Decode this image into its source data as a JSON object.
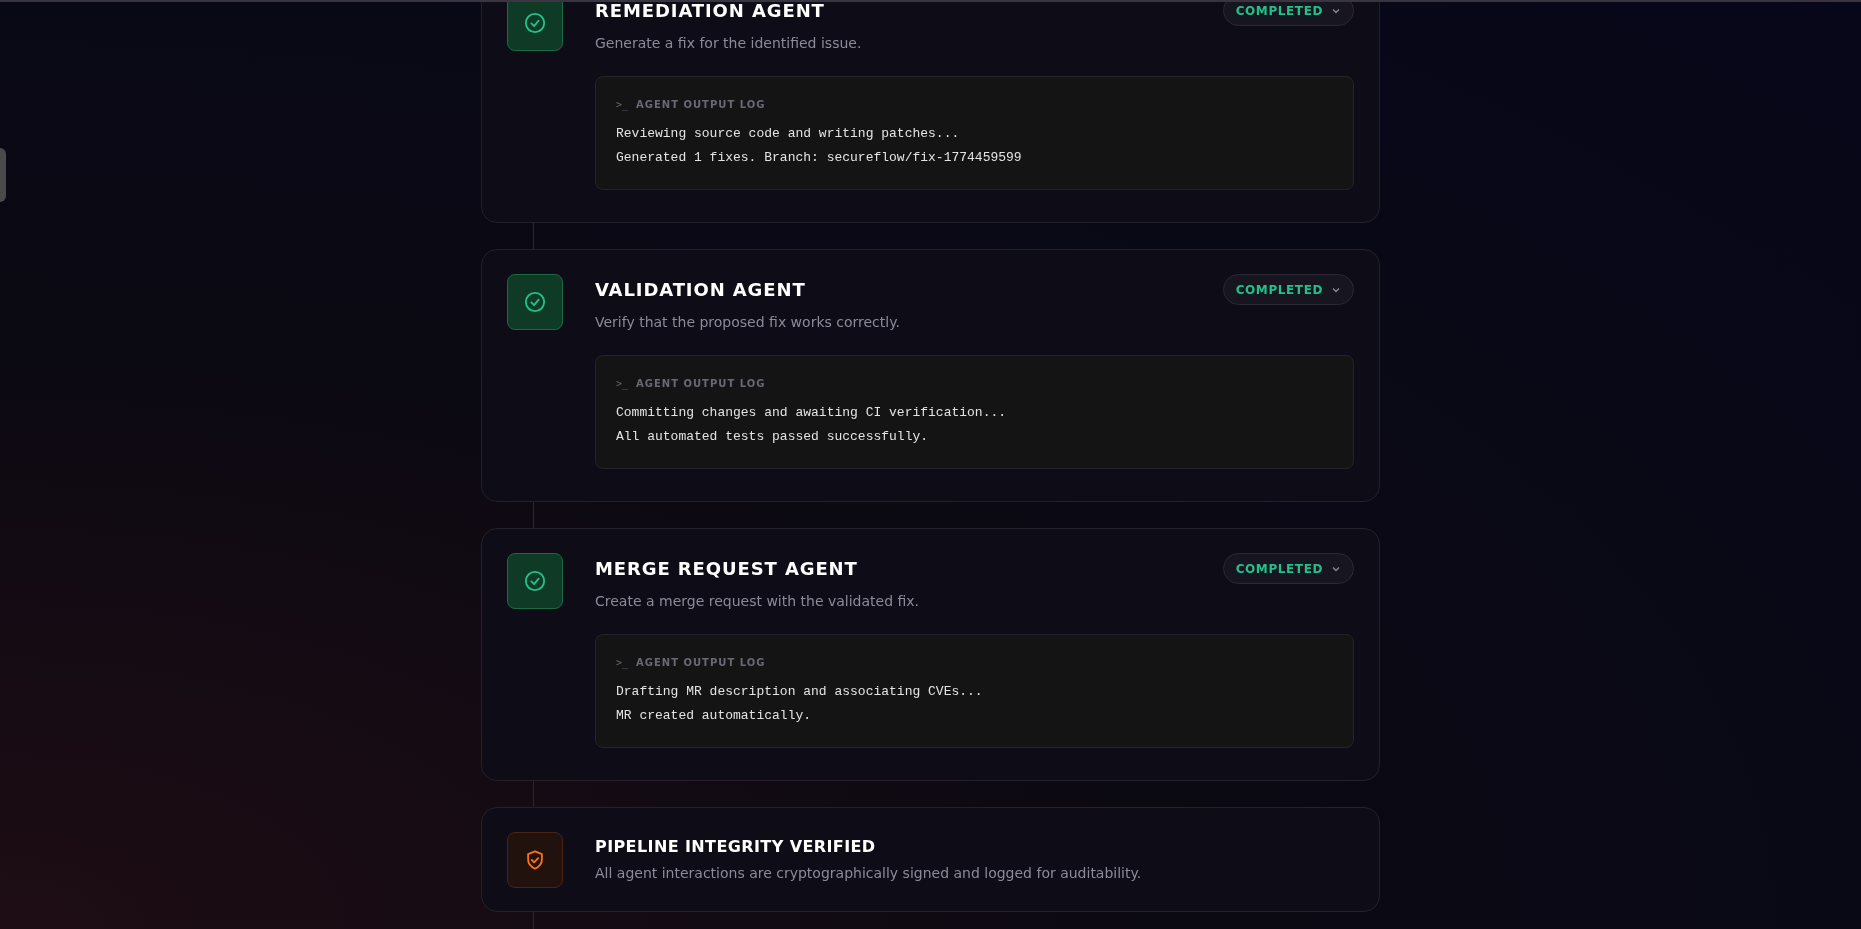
{
  "agents": [
    {
      "title": "REMEDIATION AGENT",
      "description": "Generate a fix for the identified issue.",
      "status": "COMPLETED",
      "log_prompt": ">_",
      "log_title": "AGENT OUTPUT LOG",
      "log_lines": [
        "Reviewing source code and writing patches...",
        "Generated 1 fixes. Branch: secureflow/fix-1774459599"
      ]
    },
    {
      "title": "VALIDATION AGENT",
      "description": "Verify that the proposed fix works correctly.",
      "status": "COMPLETED",
      "log_prompt": ">_",
      "log_title": "AGENT OUTPUT LOG",
      "log_lines": [
        "Committing changes and awaiting CI verification...",
        "All automated tests passed successfully."
      ]
    },
    {
      "title": "MERGE REQUEST AGENT",
      "description": "Create a merge request with the validated fix.",
      "status": "COMPLETED",
      "log_prompt": ">_",
      "log_title": "AGENT OUTPUT LOG",
      "log_lines": [
        "Drafting MR description and associating CVEs...",
        "MR created automatically."
      ]
    }
  ],
  "integrity": {
    "title": "PIPELINE INTEGRITY VERIFIED",
    "description": "All agent interactions are cryptographically signed and logged for auditability."
  }
}
